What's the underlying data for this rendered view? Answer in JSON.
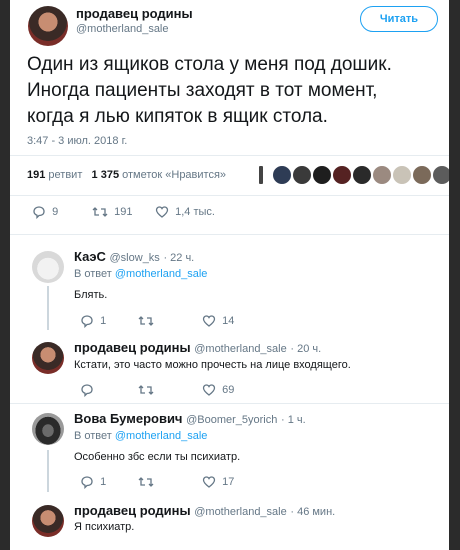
{
  "main": {
    "author_name": "продавец родины",
    "author_handle": "@motherland_sale",
    "follow_label": "Читать",
    "text_line1": "Один из ящиков стола у меня под дошик.",
    "text_line2": "Иногда пациенты заходят в тот момент,",
    "text_line3": "когда я лью кипяток в ящик стола.",
    "timestamp": "3:47 - 3 июл. 2018 г.",
    "retweets_count": "191",
    "retweets_label": "ретвит",
    "likes_count": "1 375",
    "likes_label": "отметок «Нравится»",
    "reply_count": "9",
    "retweet_count_action": "191",
    "like_count_action": "1,4 тыс."
  },
  "replies": [
    {
      "name": "КаэС",
      "handle": "@slow_ks",
      "time": "· 22 ч.",
      "in_reply_prefix": "В ответ",
      "in_reply_to": "@motherland_sale",
      "text": "Блять.",
      "reply_count": "1",
      "retweet_count": "",
      "like_count": "14"
    },
    {
      "name": "продавец родины",
      "handle": "@motherland_sale",
      "time": "· 20 ч.",
      "text": "Кстати, это часто можно прочесть на лице входящего.",
      "reply_count": "",
      "retweet_count": "",
      "like_count": "69"
    },
    {
      "name": "Вова Бумерович",
      "handle": "@Boomer_5yorich",
      "time": "· 1 ч.",
      "in_reply_prefix": "В ответ",
      "in_reply_to": "@motherland_sale",
      "text": "Особенно збс если ты психиатр.",
      "reply_count": "1",
      "retweet_count": "",
      "like_count": "17"
    },
    {
      "name": "продавец родины",
      "handle": "@motherland_sale",
      "time": "· 46 мин.",
      "text": "Я психиатр."
    }
  ],
  "colors": {
    "accent": "#1da1f2",
    "muted": "#657786",
    "text": "#14171a",
    "separator": "#e6ecf0"
  }
}
